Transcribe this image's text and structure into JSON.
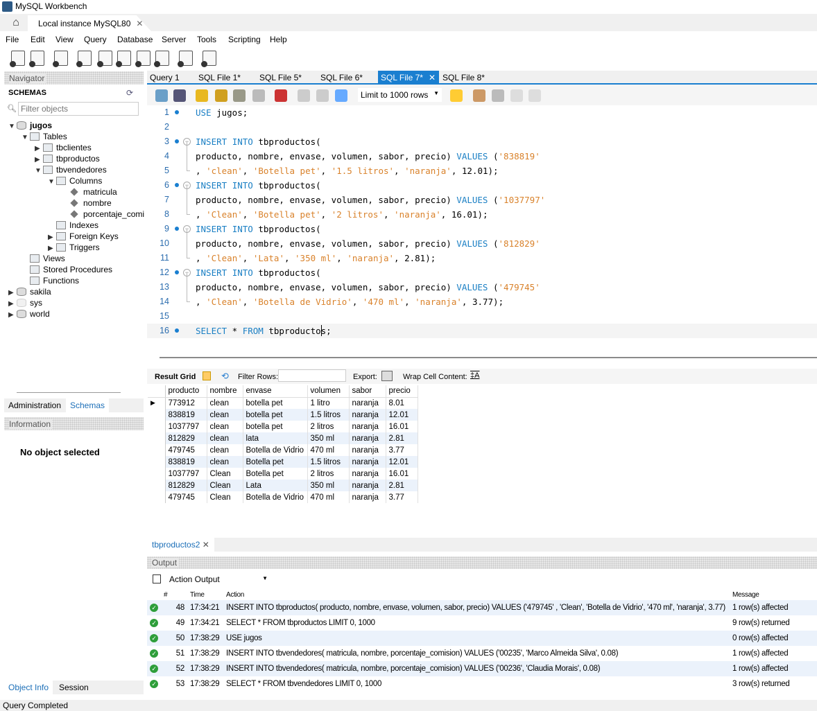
{
  "window": {
    "title": "MySQL Workbench",
    "connection_tab": "Local instance MySQL80"
  },
  "menu": [
    "File",
    "Edit",
    "View",
    "Query",
    "Database",
    "Server",
    "Tools",
    "Scripting",
    "Help"
  ],
  "toolbar_icons": [
    "new-sql-tab-icon",
    "open-sql-script-icon",
    "schema-inspector-icon",
    "create-schema-icon",
    "create-table-icon",
    "create-view-icon",
    "create-procedure-icon",
    "create-function-icon",
    "search-table-data-icon",
    "reconnect-icon"
  ],
  "navigator": {
    "title": "Navigator",
    "schemas_label": "SCHEMAS",
    "filter_placeholder": "Filter objects",
    "tree": [
      {
        "label": "jugos",
        "level": 0,
        "arrow": "▼",
        "icon": "db",
        "bold": true
      },
      {
        "label": "Tables",
        "level": 1,
        "arrow": "▼",
        "icon": "folder"
      },
      {
        "label": "tbclientes",
        "level": 2,
        "arrow": "▶",
        "icon": "table"
      },
      {
        "label": "tbproductos",
        "level": 2,
        "arrow": "▶",
        "icon": "table"
      },
      {
        "label": "tbvendedores",
        "level": 2,
        "arrow": "▼",
        "icon": "table"
      },
      {
        "label": "Columns",
        "level": 3,
        "arrow": "▼",
        "icon": "folder"
      },
      {
        "label": "matricula",
        "level": 4,
        "arrow": "",
        "icon": "col"
      },
      {
        "label": "nombre",
        "level": 4,
        "arrow": "",
        "icon": "col"
      },
      {
        "label": "porcentaje_comi",
        "level": 4,
        "arrow": "",
        "icon": "col"
      },
      {
        "label": "Indexes",
        "level": 3,
        "arrow": "",
        "icon": "folder"
      },
      {
        "label": "Foreign Keys",
        "level": 3,
        "arrow": "▶",
        "icon": "folder"
      },
      {
        "label": "Triggers",
        "level": 3,
        "arrow": "▶",
        "icon": "folder"
      },
      {
        "label": "Views",
        "level": 1,
        "arrow": "",
        "icon": "folder"
      },
      {
        "label": "Stored Procedures",
        "level": 1,
        "arrow": "",
        "icon": "folder"
      },
      {
        "label": "Functions",
        "level": 1,
        "arrow": "",
        "icon": "folder"
      },
      {
        "label": "sakila",
        "level": 0,
        "arrow": "▶",
        "icon": "db"
      },
      {
        "label": "sys",
        "level": 0,
        "arrow": "▶",
        "icon": "dbdim"
      },
      {
        "label": "world",
        "level": 0,
        "arrow": "▶",
        "icon": "db"
      }
    ],
    "tabs": [
      "Administration",
      "Schemas"
    ],
    "active_tab": "Schemas"
  },
  "information": {
    "title": "Information",
    "message": "No object selected",
    "tabs": [
      "Object Info",
      "Session"
    ],
    "active_tab": "Object Info"
  },
  "query_tabs": [
    "Query 1",
    "SQL File 1*",
    "SQL File 5*",
    "SQL File 6*",
    "SQL File 7*",
    "SQL File 8*"
  ],
  "active_query_tab": "SQL File 7*",
  "editor_toolbar": {
    "limit": "Limit to 1000 rows"
  },
  "colors": {
    "accent": "#1a7fd0",
    "keyword": "#1a7fc4",
    "string": "#d9822b",
    "success": "#2e9e3a"
  },
  "code": [
    {
      "n": "1",
      "dot": true,
      "fold": "",
      "t": [
        [
          "kw",
          "USE"
        ],
        [
          "p",
          " jugos;"
        ]
      ]
    },
    {
      "n": "2",
      "dot": false,
      "fold": "",
      "t": []
    },
    {
      "n": "3",
      "dot": true,
      "fold": "start",
      "t": [
        [
          "kw",
          "INSERT"
        ],
        [
          "p",
          " "
        ],
        [
          "kw",
          "INTO"
        ],
        [
          "p",
          " tbproductos("
        ]
      ]
    },
    {
      "n": "4",
      "dot": false,
      "fold": "mid",
      "t": [
        [
          "p",
          "producto, nombre, envase, volumen, sabor, precio) "
        ],
        [
          "kw",
          "VALUES"
        ],
        [
          "p",
          " ("
        ],
        [
          "str",
          "'838819'"
        ]
      ]
    },
    {
      "n": "5",
      "dot": false,
      "fold": "end",
      "t": [
        [
          "p",
          ", "
        ],
        [
          "str",
          "'clean'"
        ],
        [
          "p",
          ", "
        ],
        [
          "str",
          "'Botella pet'"
        ],
        [
          "p",
          ", "
        ],
        [
          "str",
          "'1.5 litros'"
        ],
        [
          "p",
          ", "
        ],
        [
          "str",
          "'naranja'"
        ],
        [
          "p",
          ", 12.01);"
        ]
      ]
    },
    {
      "n": "6",
      "dot": true,
      "fold": "start",
      "t": [
        [
          "kw",
          "INSERT"
        ],
        [
          "p",
          " "
        ],
        [
          "kw",
          "INTO"
        ],
        [
          "p",
          " tbproductos("
        ]
      ]
    },
    {
      "n": "7",
      "dot": false,
      "fold": "mid",
      "t": [
        [
          "p",
          "producto, nombre, envase, volumen, sabor, precio) "
        ],
        [
          "kw",
          "VALUES"
        ],
        [
          "p",
          " ("
        ],
        [
          "str",
          "'1037797'"
        ]
      ]
    },
    {
      "n": "8",
      "dot": false,
      "fold": "end",
      "t": [
        [
          "p",
          ", "
        ],
        [
          "str",
          "'Clean'"
        ],
        [
          "p",
          ", "
        ],
        [
          "str",
          "'Botella pet'"
        ],
        [
          "p",
          ", "
        ],
        [
          "str",
          "'2 litros'"
        ],
        [
          "p",
          ", "
        ],
        [
          "str",
          "'naranja'"
        ],
        [
          "p",
          ", 16.01);"
        ]
      ]
    },
    {
      "n": "9",
      "dot": true,
      "fold": "start",
      "t": [
        [
          "kw",
          "INSERT"
        ],
        [
          "p",
          " "
        ],
        [
          "kw",
          "INTO"
        ],
        [
          "p",
          " tbproductos("
        ]
      ]
    },
    {
      "n": "10",
      "dot": false,
      "fold": "mid",
      "t": [
        [
          "p",
          "producto, nombre, envase, volumen, sabor, precio) "
        ],
        [
          "kw",
          "VALUES"
        ],
        [
          "p",
          " ("
        ],
        [
          "str",
          "'812829'"
        ]
      ]
    },
    {
      "n": "11",
      "dot": false,
      "fold": "end",
      "t": [
        [
          "p",
          ", "
        ],
        [
          "str",
          "'Clean'"
        ],
        [
          "p",
          ", "
        ],
        [
          "str",
          "'Lata'"
        ],
        [
          "p",
          ", "
        ],
        [
          "str",
          "'350 ml'"
        ],
        [
          "p",
          ", "
        ],
        [
          "str",
          "'naranja'"
        ],
        [
          "p",
          ", 2.81);"
        ]
      ]
    },
    {
      "n": "12",
      "dot": true,
      "fold": "start",
      "t": [
        [
          "kw",
          "INSERT"
        ],
        [
          "p",
          " "
        ],
        [
          "kw",
          "INTO"
        ],
        [
          "p",
          " tbproductos("
        ]
      ]
    },
    {
      "n": "13",
      "dot": false,
      "fold": "mid",
      "t": [
        [
          "p",
          "producto, nombre, envase, volumen, sabor, precio) "
        ],
        [
          "kw",
          "VALUES"
        ],
        [
          "p",
          " ("
        ],
        [
          "str",
          "'479745'"
        ]
      ]
    },
    {
      "n": "14",
      "dot": false,
      "fold": "end",
      "t": [
        [
          "p",
          ", "
        ],
        [
          "str",
          "'Clean'"
        ],
        [
          "p",
          ", "
        ],
        [
          "str",
          "'Botella de Vidrio'"
        ],
        [
          "p",
          ", "
        ],
        [
          "str",
          "'470 ml'"
        ],
        [
          "p",
          ", "
        ],
        [
          "str",
          "'naranja'"
        ],
        [
          "p",
          ", 3.77);"
        ]
      ]
    },
    {
      "n": "15",
      "dot": false,
      "fold": "",
      "t": []
    },
    {
      "n": "16",
      "dot": true,
      "fold": "",
      "t": [
        [
          "kw",
          "SELECT"
        ],
        [
          "p",
          " * "
        ],
        [
          "kw",
          "FROM"
        ],
        [
          "p",
          " tbproductos;"
        ]
      ]
    }
  ],
  "result_toolbar": {
    "result_grid": "Result Grid",
    "filter_rows": "Filter Rows:",
    "export": "Export:",
    "wrap": "Wrap Cell Content:"
  },
  "result": {
    "columns": [
      "producto",
      "nombre",
      "envase",
      "volumen",
      "sabor",
      "precio"
    ],
    "rows": [
      [
        "773912",
        "clean",
        "botella pet",
        "1 litro",
        "naranja",
        "8.01"
      ],
      [
        "838819",
        "clean",
        "botella pet",
        "1.5 litros",
        "naranja",
        "12.01"
      ],
      [
        "1037797",
        "clean",
        "botella pet",
        "2 litros",
        "naranja",
        "16.01"
      ],
      [
        "812829",
        "clean",
        "lata",
        "350 ml",
        "naranja",
        "2.81"
      ],
      [
        "479745",
        "clean",
        "Botella de Vidrio",
        "470 ml",
        "naranja",
        "3.77"
      ],
      [
        "838819",
        "clean",
        "Botella pet",
        "1.5 litros",
        "naranja",
        "12.01"
      ],
      [
        "1037797",
        "Clean",
        "Botella pet",
        "2 litros",
        "naranja",
        "16.01"
      ],
      [
        "812829",
        "Clean",
        "Lata",
        "350 ml",
        "naranja",
        "2.81"
      ],
      [
        "479745",
        "Clean",
        "Botella de Vidrio",
        "470 ml",
        "naranja",
        "3.77"
      ]
    ]
  },
  "result_tab": "tbproductos2",
  "output": {
    "title": "Output",
    "selector": "Action Output",
    "columns": [
      "#",
      "Time",
      "Action",
      "Message"
    ],
    "rows": [
      [
        "48",
        "17:34:21",
        "INSERT INTO tbproductos( producto, nombre, envase, volumen, sabor, precio) VALUES ('479745' , 'Clean', 'Botella de Vidrio', '470 ml', 'naranja', 3.77)",
        "1 row(s) affected"
      ],
      [
        "49",
        "17:34:21",
        "SELECT * FROM tbproductos LIMIT 0, 1000",
        "9 row(s) returned"
      ],
      [
        "50",
        "17:38:29",
        "USE jugos",
        "0 row(s) affected"
      ],
      [
        "51",
        "17:38:29",
        "INSERT INTO tbvendedores( matricula, nombre, porcentaje_comision) VALUES ('00235', 'Marco Almeida Silva', 0.08)",
        "1 row(s) affected"
      ],
      [
        "52",
        "17:38:29",
        "INSERT INTO tbvendedores( matricula, nombre, porcentaje_comision) VALUES ('00236', 'Claudia Morais', 0.08)",
        "1 row(s) affected"
      ],
      [
        "53",
        "17:38:29",
        "SELECT * FROM tbvendedores LIMIT 0, 1000",
        "3 row(s) returned"
      ]
    ]
  },
  "status": "Query Completed"
}
